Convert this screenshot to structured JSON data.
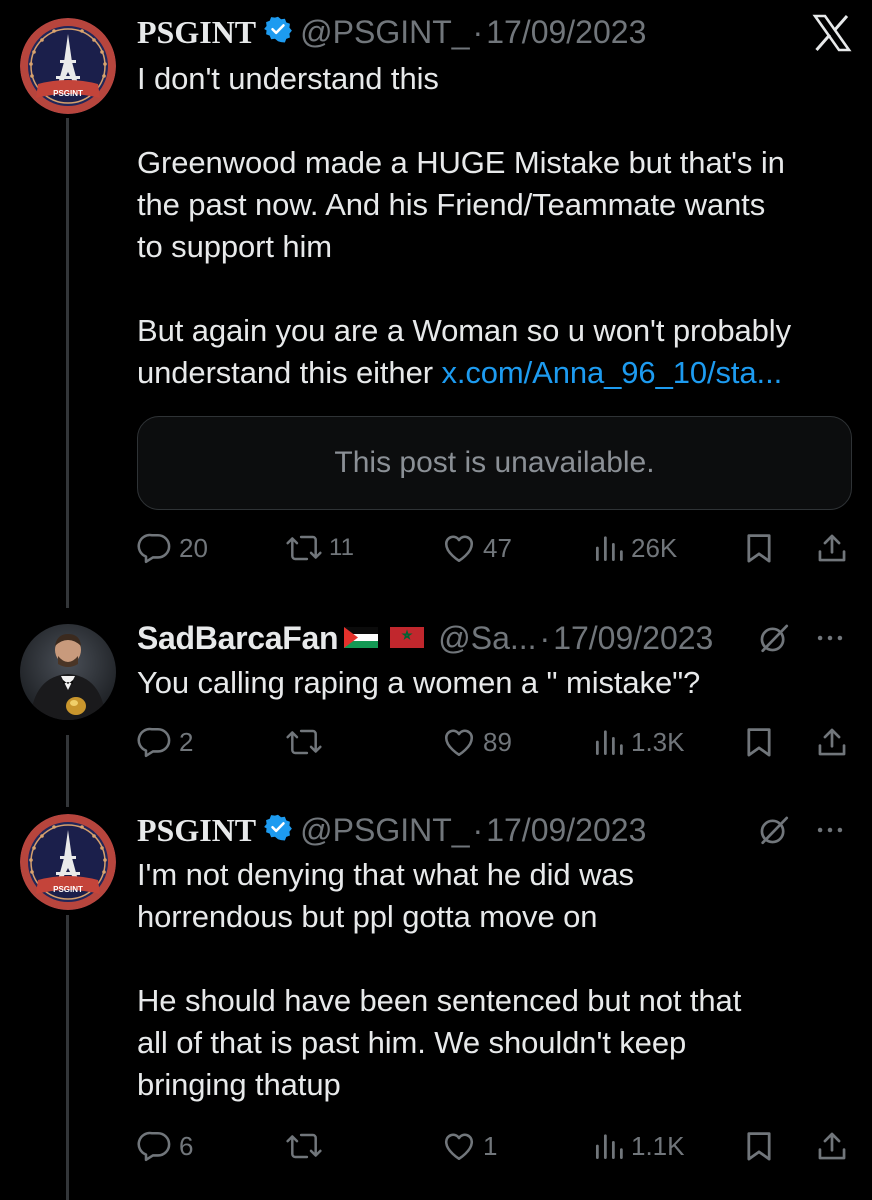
{
  "app": {
    "logo_icon": "x-logo-icon"
  },
  "tweets": [
    {
      "display_name": "PSGINT",
      "verified": true,
      "handle": "@PSGINT_",
      "date": "17/09/2023",
      "avatar_text": "PSGINT",
      "lines": [
        "I don't understand this",
        "",
        "Greenwood made a HUGE Mistake but that's in",
        "the past now. And his Friend/Teammate wants",
        "to support him",
        "",
        "But again you are a Woman so u won't probably"
      ],
      "last_line_text": "understand this either ",
      "link_text": "x.com/Anna_96_10/sta...",
      "quoted_unavailable": "This post is unavailable.",
      "replies": "20",
      "reposts": "11",
      "likes": "47",
      "views": "26K"
    },
    {
      "display_name": "SadBarcaFan",
      "flags": [
        "palestine-flag-icon",
        "morocco-flag-icon"
      ],
      "handle": "@Sa...",
      "date": "17/09/2023",
      "lines": [
        "You calling raping a women a \" mistake\"?"
      ],
      "replies": "2",
      "reposts": "",
      "likes": "89",
      "views": "1.3K"
    },
    {
      "display_name": "PSGINT",
      "verified": true,
      "handle": "@PSGINT_",
      "date": "17/09/2023",
      "avatar_text": "PSGINT",
      "lines": [
        "I'm not denying that what he did was",
        "horrendous but ppl gotta move on",
        "",
        "He should have been sentenced but not that",
        "all of that is past him. We shouldn't keep",
        "bringing thatup"
      ],
      "replies": "6",
      "reposts": "",
      "likes": "1",
      "views": "1.1K"
    }
  ],
  "colors": {
    "background": "#000000",
    "text": "#e7e9ea",
    "muted": "#71767b",
    "link": "#1d9bf0",
    "verified": "#1d9bf0",
    "thread_line": "#333639"
  }
}
